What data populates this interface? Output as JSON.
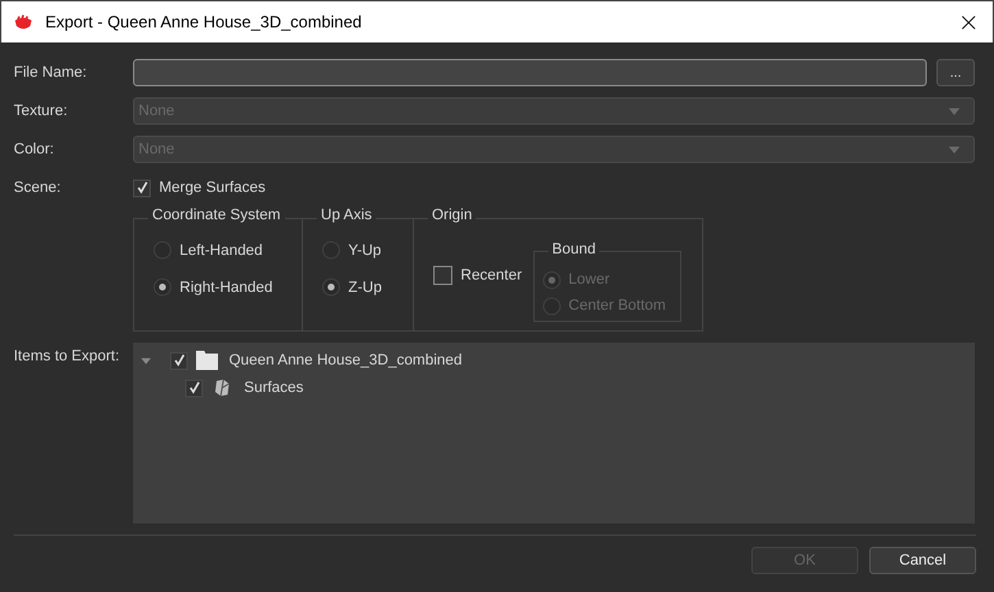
{
  "window": {
    "title": "Export - Queen Anne House_3D_combined"
  },
  "file_name": {
    "label": "File Name:",
    "browse": "..."
  },
  "texture": {
    "label": "Texture:",
    "value": "None",
    "disabled": true
  },
  "color": {
    "label": "Color:",
    "value": "None",
    "disabled": true
  },
  "scene": {
    "label": "Scene:",
    "option": {
      "label": "Merge Surfaces",
      "checked": true
    }
  },
  "coordinate_system": {
    "title": "Coordinate System",
    "options": [
      {
        "label": "Left-Handed",
        "selected": false
      },
      {
        "label": "Right-Handed",
        "selected": true
      }
    ]
  },
  "up_axis": {
    "title": "Up Axis",
    "options": [
      {
        "label": "Y-Up",
        "selected": false
      },
      {
        "label": "Z-Up",
        "selected": true
      }
    ]
  },
  "origin": {
    "title": "Origin",
    "recenter": {
      "label": "Recenter",
      "checked": false
    },
    "bound": {
      "title": "Bound",
      "disabled": true,
      "options": [
        {
          "label": "Lower",
          "selected": true
        },
        {
          "label": "Center Bottom",
          "selected": false
        }
      ]
    }
  },
  "items": {
    "label": "Items to Export:",
    "tree": [
      {
        "label": "Queen Anne House_3D_combined",
        "kind": "folder",
        "checked": true,
        "expanded": true,
        "children": [
          {
            "label": "Surfaces",
            "kind": "surface",
            "checked": true
          }
        ]
      }
    ]
  },
  "buttons": [
    {
      "label": "OK",
      "disabled": true
    },
    {
      "label": "Cancel",
      "disabled": false
    }
  ]
}
